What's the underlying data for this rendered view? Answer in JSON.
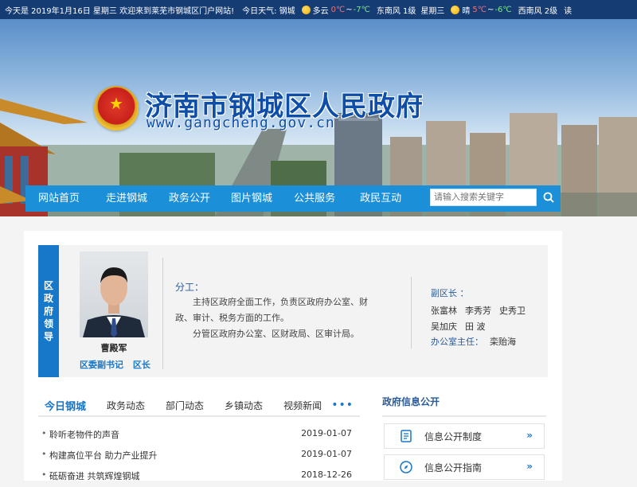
{
  "topbar": {
    "date": "今天是 2019年1月16日 星期三 欢迎来到莱芜市钢城区门户网站!",
    "weather_label": "今日天气: 钢城",
    "today_cond": "多云",
    "today_temp": "0℃",
    "today_temp_sep": "~",
    "today_low": "-7℃",
    "today_wind": "东南风 1级",
    "today_day": "星期三",
    "tomorrow_cond": "晴",
    "tomorrow_temp": "5℃",
    "tomorrow_temp_sep": "~",
    "tomorrow_low": "-6℃",
    "tomorrow_wind": "西南风 2级",
    "more": "读"
  },
  "header": {
    "title": "济南市钢城区人民政府",
    "url": "www.gangcheng.gov.cn"
  },
  "nav": {
    "items": [
      {
        "label": "网站首页"
      },
      {
        "label": "走进钢城"
      },
      {
        "label": "政务公开"
      },
      {
        "label": "图片钢城"
      },
      {
        "label": "公共服务"
      },
      {
        "label": "政民互动"
      }
    ],
    "search_placeholder": "请输入搜索关键字"
  },
  "leader": {
    "tag": "区政府领导",
    "name": "曹殿军",
    "roles": [
      "区委副书记",
      "区长"
    ],
    "duty_title": "分工：",
    "duty_lines": [
      "主持区政府全面工作，负责区政府办公室、财政、审计、税务方面的工作。",
      "分管区政府办公室、区财政局、区审计局。"
    ],
    "deputy_title": "副区长 ：",
    "deputies": [
      "张富林",
      "李秀芳",
      "史秀卫",
      "吴加庆",
      "田 波"
    ],
    "office_title": "办公室主任：",
    "office_name": "栾贻海"
  },
  "tabs": {
    "items": [
      {
        "label": "今日钢城",
        "active": true
      },
      {
        "label": "政务动态",
        "active": false
      },
      {
        "label": "部门动态",
        "active": false
      },
      {
        "label": "乡镇动态",
        "active": false
      },
      {
        "label": "视频新闻",
        "active": false
      }
    ],
    "more": "•••"
  },
  "news": [
    {
      "title": "聆听老物件的声音",
      "date": "2019-01-07"
    },
    {
      "title": "构建高位平台 助力产业提升",
      "date": "2019-01-07"
    },
    {
      "title": "砥砺奋进 共筑辉煌钢城",
      "date": "2018-12-26"
    }
  ],
  "info": {
    "title": "政府信息公开",
    "buttons": [
      {
        "label": "信息公开制度",
        "icon": "document-icon"
      },
      {
        "label": "信息公开指南",
        "icon": "compass-icon"
      }
    ],
    "arrow": "»"
  },
  "colors": {
    "accent": "#1b8fd8",
    "tag": "#1777c8",
    "title": "#0e4ea8"
  }
}
